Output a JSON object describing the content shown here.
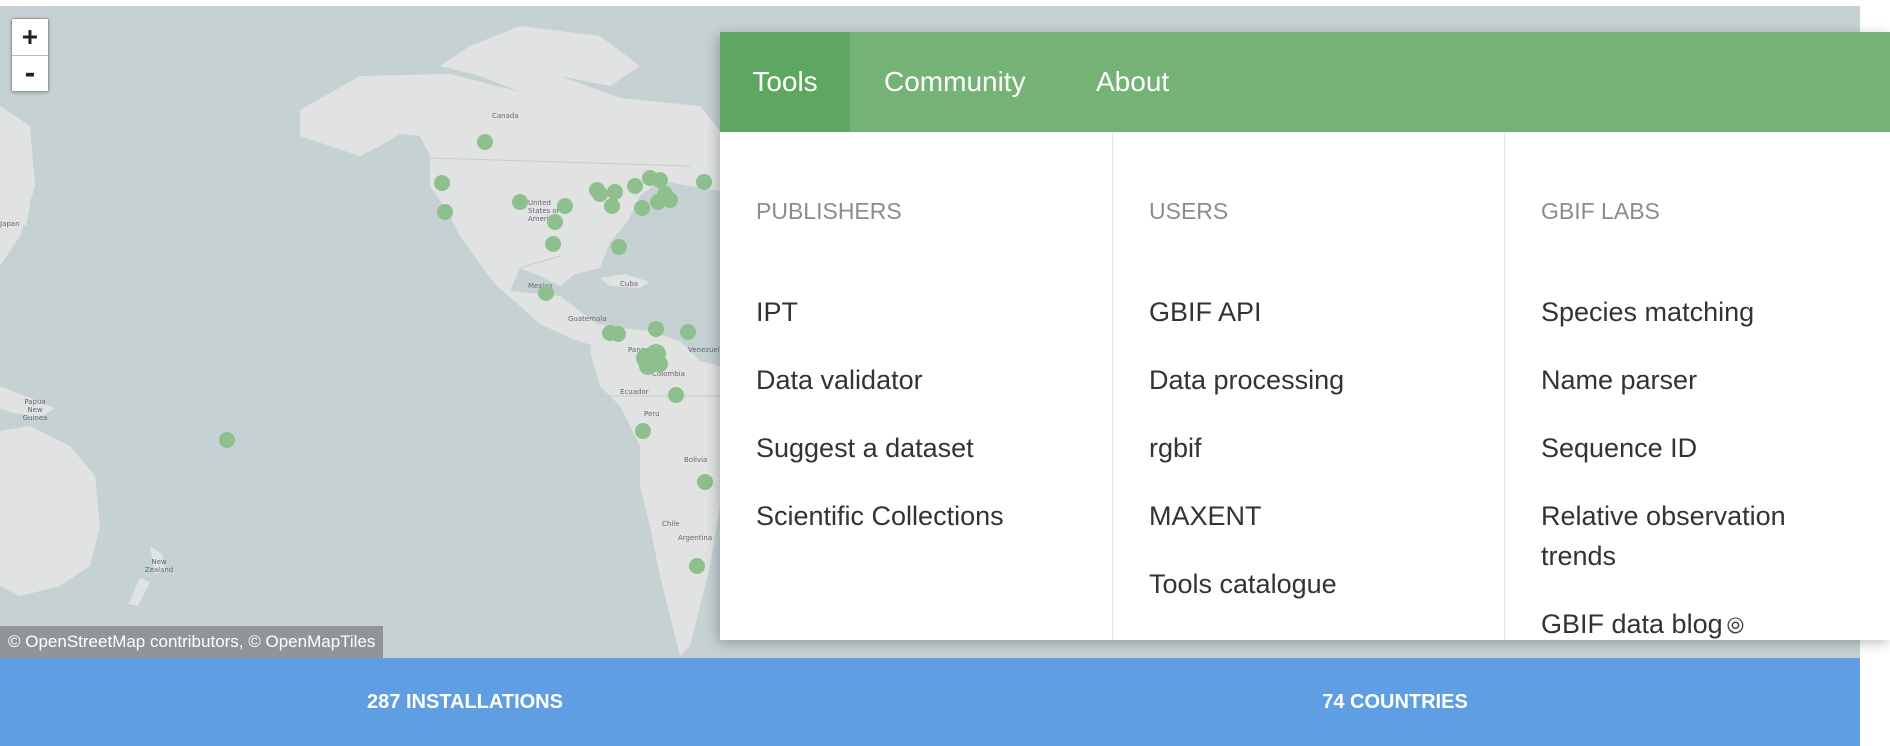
{
  "map": {
    "zoom_in_label": "+",
    "zoom_out_label": "-",
    "attribution": "© OpenStreetMap contributors, © OpenMapTiles",
    "labels": {
      "canada": "Canada",
      "usa": "United States of America",
      "japan": "Japan",
      "mexico": "Mexico",
      "cuba": "Cuba",
      "guatemala": "Guatemala",
      "panama": "Panama",
      "venezuela": "Venezuela",
      "colombia": "Colombia",
      "ecuador": "Ecuador",
      "peru": "Peru",
      "bolivia": "Bolivia",
      "chile": "Chile",
      "argentina": "Argentina",
      "png": "Papua New Guinea",
      "nz": "New Zealand"
    },
    "colors": {
      "water": "#c6d1d4",
      "land": "#e1e3e2",
      "marker": "#8dc08c"
    }
  },
  "nav": {
    "tabs": [
      {
        "label": "Tools",
        "active": true
      },
      {
        "label": "Community",
        "active": false
      },
      {
        "label": "About",
        "active": false
      }
    ],
    "columns": [
      {
        "heading": "PUBLISHERS",
        "items": [
          "IPT",
          "Data validator",
          "Suggest a dataset",
          "Scientific Collections"
        ]
      },
      {
        "heading": "USERS",
        "items": [
          "GBIF API",
          "Data processing",
          "rgbif",
          "MAXENT",
          "Tools catalogue"
        ]
      },
      {
        "heading": "GBIF LABS",
        "items": [
          "Species matching",
          "Name parser",
          "Sequence ID",
          "Relative observation trends",
          "GBIF data blog"
        ],
        "external_link_icon": "link-icon"
      }
    ],
    "colors": {
      "bar": "#74b276",
      "active_tab": "#5ea761"
    }
  },
  "stats": {
    "installations": "287 INSTALLATIONS",
    "countries": "74 COUNTRIES",
    "color": "#609ee3"
  }
}
